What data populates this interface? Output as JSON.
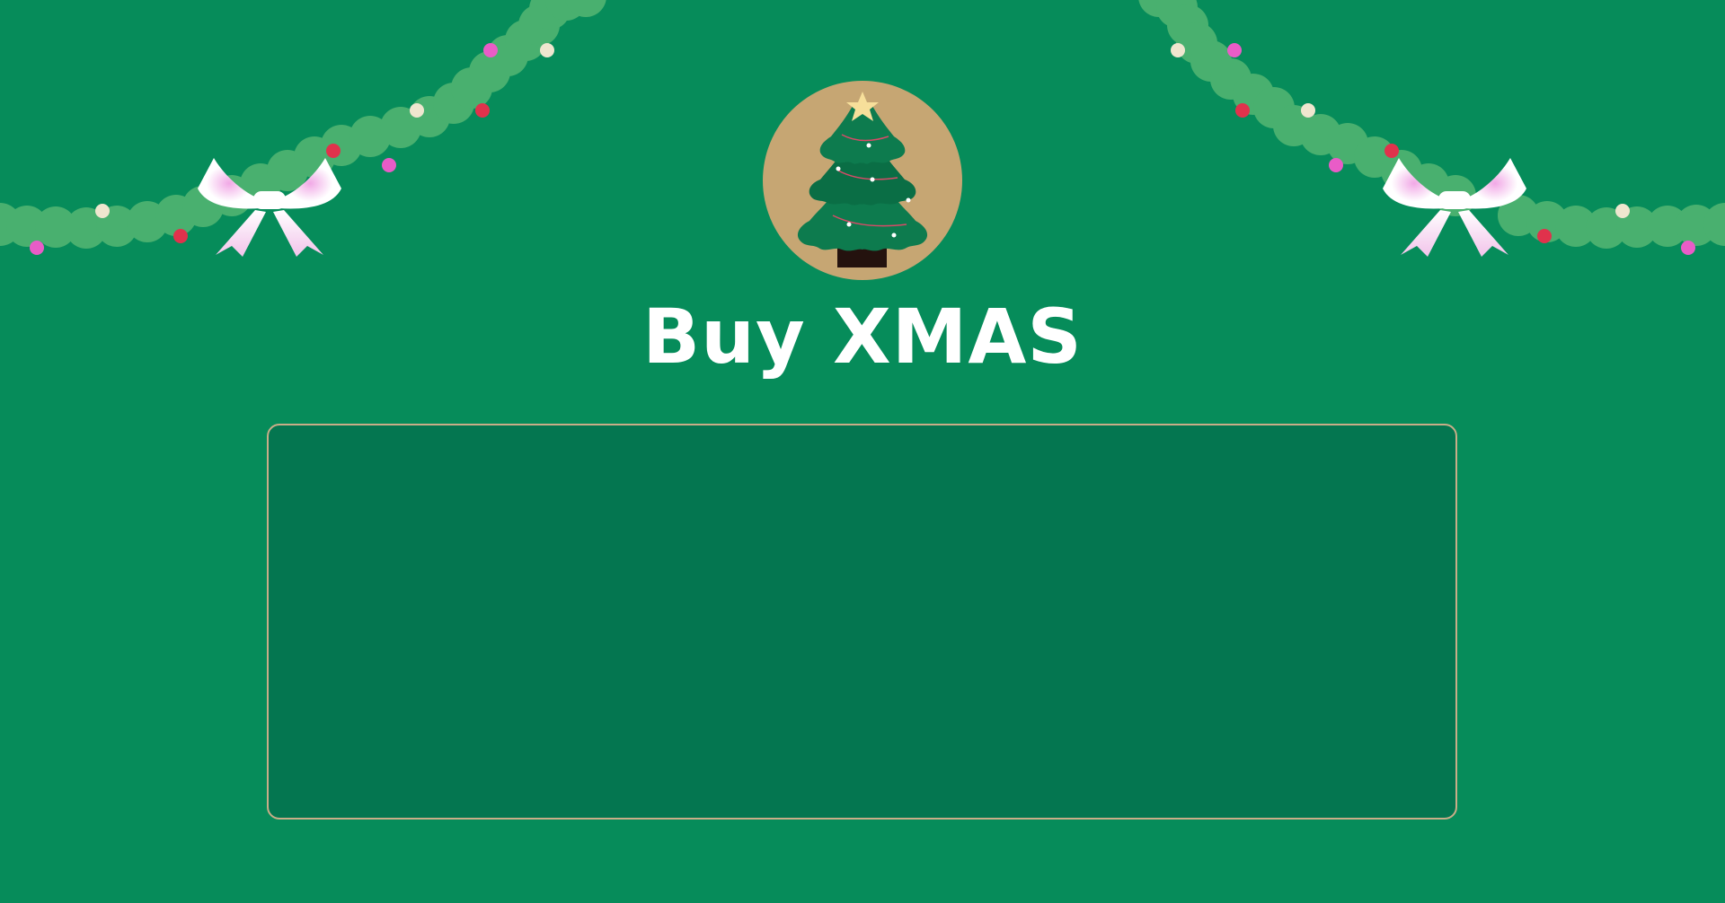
{
  "page": {
    "title": "Buy XMAS"
  },
  "colors": {
    "background": "#068c5a",
    "panel": "#047650",
    "panel_border": "#c9ad88",
    "garland": "#49b06f",
    "logo_circle": "#c6a673"
  },
  "icons": {
    "logo": "christmas-tree-icon",
    "bow": "bow-icon"
  }
}
